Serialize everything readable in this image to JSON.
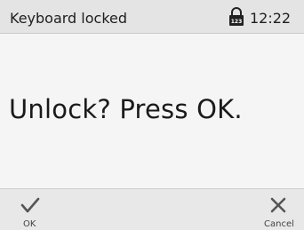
{
  "status_bar": {
    "title": "Keyboard locked",
    "lock_icon": "keypad-lock-icon",
    "time": "12:22"
  },
  "main": {
    "message": "Unlock? Press OK."
  },
  "softkeys": {
    "left": {
      "label": "OK",
      "icon": "check-icon"
    },
    "right": {
      "label": "Cancel",
      "icon": "close-icon"
    }
  },
  "colors": {
    "status_bar_bg": "#e4e4e4",
    "body_bg": "#f5f5f5",
    "softkey_bar_bg": "#e8e8e8",
    "text": "#1a1a1a",
    "icon": "#555555"
  }
}
